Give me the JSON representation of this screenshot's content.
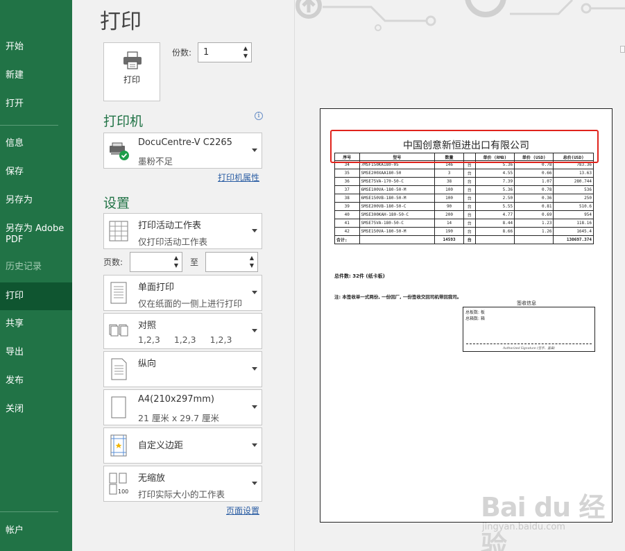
{
  "sidebar": {
    "items": [
      {
        "label": "开始"
      },
      {
        "label": "新建"
      },
      {
        "label": "打开"
      },
      {
        "label": "信息"
      },
      {
        "label": "保存"
      },
      {
        "label": "另存为"
      },
      {
        "label": "另存为 Adobe PDF"
      },
      {
        "label": "历史记录"
      },
      {
        "label": "打印"
      },
      {
        "label": "共享"
      },
      {
        "label": "导出"
      },
      {
        "label": "发布"
      },
      {
        "label": "关闭"
      },
      {
        "label": "帐户"
      }
    ]
  },
  "main": {
    "title": "打印",
    "print_button": "打印",
    "copies_label": "份数:",
    "copies_value": "1",
    "printer_heading": "打印机",
    "printer_name": "DocuCentre-V C2265",
    "printer_status": "墨粉不足",
    "printer_properties": "打印机属性",
    "settings_heading": "设置",
    "settings": [
      {
        "t1": "打印活动工作表",
        "t2": "仅打印活动工作表",
        "icon": "sheet-grid-icon"
      },
      {
        "t1": "单面打印",
        "t2": "仅在纸面的一侧上进行打印",
        "icon": "one-sided-icon"
      },
      {
        "t1": "对照",
        "t2a": "1,2,3",
        "t2b": "1,2,3",
        "t2c": "1,2,3",
        "icon": "collate-icon"
      },
      {
        "t1": "纵向",
        "t2": "",
        "icon": "portrait-icon"
      },
      {
        "t1": "A4(210x297mm)",
        "t2": "21 厘米 x 29.7 厘米",
        "icon": "paper-size-icon"
      },
      {
        "t1": "自定义边距",
        "t2": "",
        "icon": "margins-icon"
      },
      {
        "t1": "无缩放",
        "t2": "打印实际大小的工作表",
        "icon": "no-scaling-icon"
      }
    ],
    "pages_label": "页数:",
    "pages_to": "至",
    "page_setup": "页面设置"
  },
  "preview": {
    "doc_title": "中国创意新恒进出口有限公司",
    "headers": [
      "序号",
      "型号",
      "数量",
      "",
      "单价 (RMB)",
      "单价 (USD)",
      "总价(USD)"
    ],
    "rows": [
      [
        "34",
        "7MSF150KA180-05",
        "146",
        "台",
        "5.36",
        "0.78",
        "783.36"
      ],
      [
        "35",
        "SMSE200XAA180-50",
        "3",
        "台",
        "4.55",
        "0.66",
        "13.63"
      ],
      [
        "36",
        "SMSE75VA-170-50-C",
        "38",
        "台",
        "7.39",
        "1.07",
        "280.744"
      ],
      [
        "37",
        "6MSE100VA-180-50-M",
        "100",
        "台",
        "5.36",
        "0.78",
        "536"
      ],
      [
        "38",
        "6MSE150VB-180-50-M",
        "100",
        "台",
        "2.50",
        "0.36",
        "250"
      ],
      [
        "39",
        "SMSE200VB-180-50-C",
        "90",
        "台",
        "5.55",
        "0.81",
        "510.6"
      ],
      [
        "40",
        "SMSE300KAH-180-50-C",
        "200",
        "台",
        "4.77",
        "0.69",
        "954"
      ],
      [
        "41",
        "SMSE75VA-180-50-C",
        "14",
        "台",
        "8.44",
        "1.23",
        "118.16"
      ],
      [
        "42",
        "SMSE150VA-180-50-M",
        "190",
        "台",
        "8.66",
        "1.26",
        "1645.4"
      ]
    ],
    "total_label": "合计:",
    "total_qty": "14593",
    "total_unit": "台",
    "total_value": "130697.374",
    "pieces_note": "总件数: 32件 (纸卡板)",
    "footnote": "注: 本签收单一式两份, 一份回厂, 一份签收交回司机带回我司。",
    "receipt_title": "签收信息",
    "receipt_line1": "总板数:      板",
    "receipt_line2": "总箱数:      箱",
    "receipt_sig": "Authorized Signature (签字、盖章)"
  },
  "watermark": {
    "brand": "Bai du 经验",
    "url": "jingyan.baidu.com"
  },
  "colors": {
    "sidebar": "#217346",
    "sidebar_active": "#0f5530",
    "accent_green": "#217346",
    "highlight_red": "#e0231c",
    "link": "#2a5da3"
  }
}
